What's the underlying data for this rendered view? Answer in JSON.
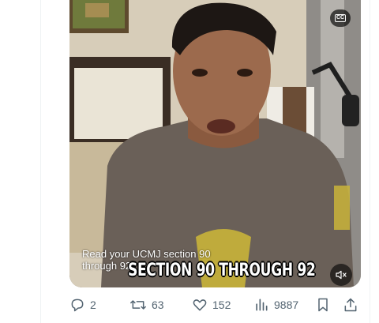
{
  "video": {
    "cc_label": "CC",
    "caption_text": "Read your UCMJ section 90 through 92",
    "overlay_text": "SECTION 90 THROUGH 92"
  },
  "actions": {
    "replies": "2",
    "reposts": "63",
    "likes": "152",
    "views": "9887"
  },
  "icons": {
    "cc": "closed-captions-icon",
    "mute": "speaker-muted-icon",
    "reply": "reply-bubble-icon",
    "repost": "repost-icon",
    "like": "heart-icon",
    "views": "views-bar-chart-icon",
    "bookmark": "bookmark-icon",
    "share": "share-upload-icon"
  },
  "colors": {
    "action_icon": "#536471",
    "timeline_border": "#eff3f4"
  }
}
